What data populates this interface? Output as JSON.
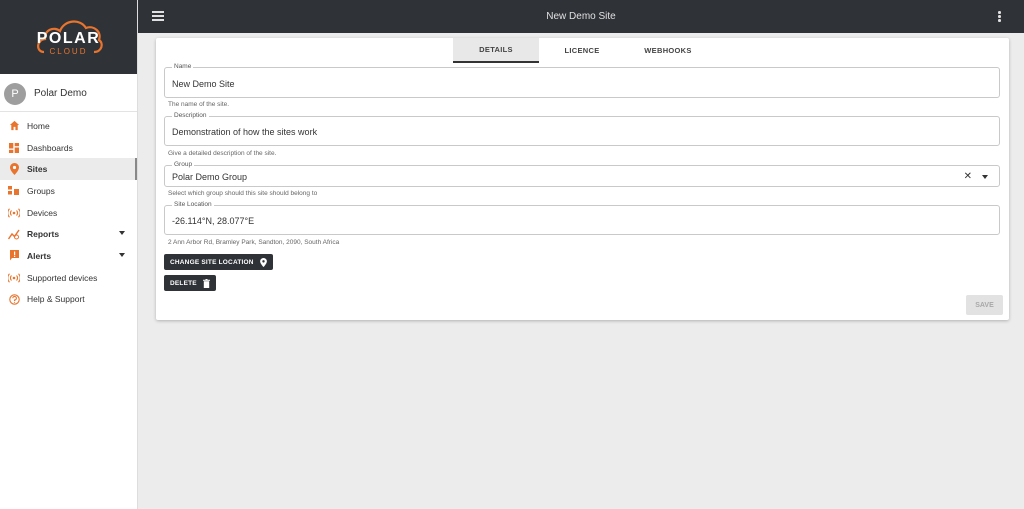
{
  "app": {
    "logo_text": "POLAR",
    "logo_subtext": "CLOUD",
    "brand_color": "#e8742e",
    "topbar_color": "#2f3237"
  },
  "topbar": {
    "title": "New Demo Site",
    "menu_icon": "hamburger-icon",
    "more_icon": "kebab-icon"
  },
  "user": {
    "initial": "P",
    "name": "Polar Demo"
  },
  "sidebar": {
    "items": [
      {
        "label": "Home",
        "icon": "home-icon"
      },
      {
        "label": "Dashboards",
        "icon": "dashboard-icon"
      },
      {
        "label": "Sites",
        "icon": "location-pin-icon",
        "active": true
      },
      {
        "label": "Groups",
        "icon": "groups-icon"
      },
      {
        "label": "Devices",
        "icon": "broadcast-icon"
      },
      {
        "label": "Reports",
        "icon": "chart-icon",
        "expandable": true
      },
      {
        "label": "Alerts",
        "icon": "alert-icon",
        "expandable": true
      },
      {
        "label": "Supported devices",
        "icon": "broadcast-icon"
      },
      {
        "label": "Help & Support",
        "icon": "help-icon"
      }
    ]
  },
  "tabs": [
    "DETAILS",
    "LICENCE",
    "WEBHOOKS"
  ],
  "form": {
    "name": {
      "label": "Name",
      "value": "New Demo Site",
      "hint": "The name of the site."
    },
    "description": {
      "label": "Description",
      "value": "Demonstration of how the sites work",
      "hint": "Give a detailed description of the site."
    },
    "group": {
      "label": "Group",
      "value": "Polar Demo Group",
      "hint": "Select which group should this site should belong to",
      "clear": "✕"
    },
    "location": {
      "label": "Site Location",
      "value": "-26.114°N, 28.077°E",
      "hint": "2 Ann Arbor Rd, Bramley Park, Sandton, 2090, South Africa"
    }
  },
  "buttons": {
    "change_location": "CHANGE SITE LOCATION",
    "delete": "DELETE",
    "save": "SAVE"
  }
}
